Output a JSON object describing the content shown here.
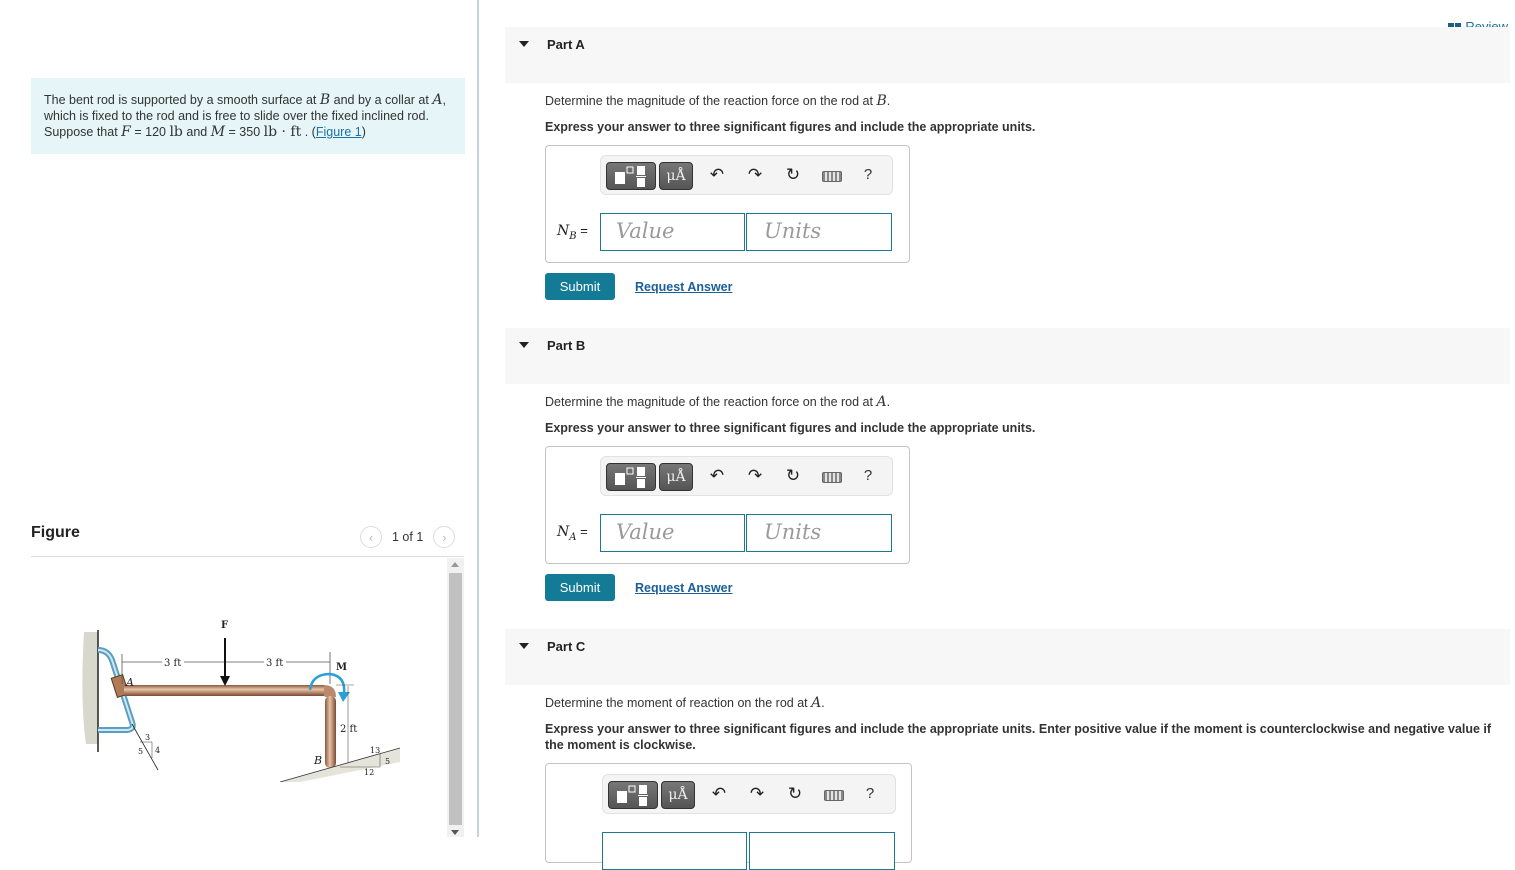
{
  "review": {
    "label": "Review",
    "icon": "book-icon"
  },
  "problem": {
    "segments": [
      {
        "t": "text",
        "v": "The bent rod is supported by a smooth surface at "
      },
      {
        "t": "math",
        "v": "B"
      },
      {
        "t": "text",
        "v": " and by a collar at "
      },
      {
        "t": "math",
        "v": "A"
      },
      {
        "t": "text",
        "v": ", which is fixed to the rod and is free to slide over the fixed inclined rod. Suppose that "
      },
      {
        "t": "math",
        "v": "F"
      },
      {
        "t": "text",
        "v": " = 120 "
      },
      {
        "t": "unit",
        "v": "lb"
      },
      {
        "t": "text",
        "v": " and "
      },
      {
        "t": "math",
        "v": "M"
      },
      {
        "t": "text",
        "v": " = 350 "
      },
      {
        "t": "unit",
        "v": "lb · ft"
      },
      {
        "t": "text",
        "v": " . ("
      },
      {
        "t": "link",
        "v": "Figure 1"
      },
      {
        "t": "text",
        "v": ")"
      }
    ]
  },
  "figure": {
    "title": "Figure",
    "counter": "1 of 1",
    "prev_icon": "chevron-left-icon",
    "next_icon": "chevron-right-icon",
    "labels": {
      "F": "F",
      "M": "M",
      "A": "A",
      "B": "B",
      "dim_left": "3 ft",
      "dim_right": "3 ft",
      "dim_vertical": "2 ft",
      "slope_A_3": "3",
      "slope_A_4": "4",
      "slope_A_5": "5",
      "slope_B_13": "13",
      "slope_B_12": "12",
      "slope_B_5": "5"
    }
  },
  "toolbar": {
    "icons": [
      "fraction-template-icon",
      "units-mu-icon",
      "undo-icon",
      "redo-icon",
      "reset-icon",
      "keyboard-icon",
      "help-icon"
    ],
    "mu_label": "μÅ",
    "help_label": "?"
  },
  "parts": [
    {
      "label": "Part A",
      "question_pre": "Determine the magnitude of the reaction force on the rod at ",
      "question_var": "B",
      "question_post": ".",
      "instruction": "Express your answer to three significant figures and include the appropriate units.",
      "var_main": "N",
      "var_sub": "B",
      "eq": " =",
      "value_placeholder": "Value",
      "units_placeholder": "Units",
      "submit_label": "Submit",
      "request_label": "Request Answer"
    },
    {
      "label": "Part B",
      "question_pre": "Determine the magnitude of the reaction force on the rod at ",
      "question_var": "A",
      "question_post": ".",
      "instruction": "Express your answer to three significant figures and include the appropriate units.",
      "var_main": "N",
      "var_sub": "A",
      "eq": " =",
      "value_placeholder": "Value",
      "units_placeholder": "Units",
      "submit_label": "Submit",
      "request_label": "Request Answer"
    },
    {
      "label": "Part C",
      "question_pre": "Determine the moment of reaction on the rod at ",
      "question_var": "A",
      "question_post": ".",
      "instruction": "Express your answer to three significant figures and include the appropriate units. Enter positive value if the moment is counterclockwise and negative value if the moment is clockwise."
    }
  ]
}
